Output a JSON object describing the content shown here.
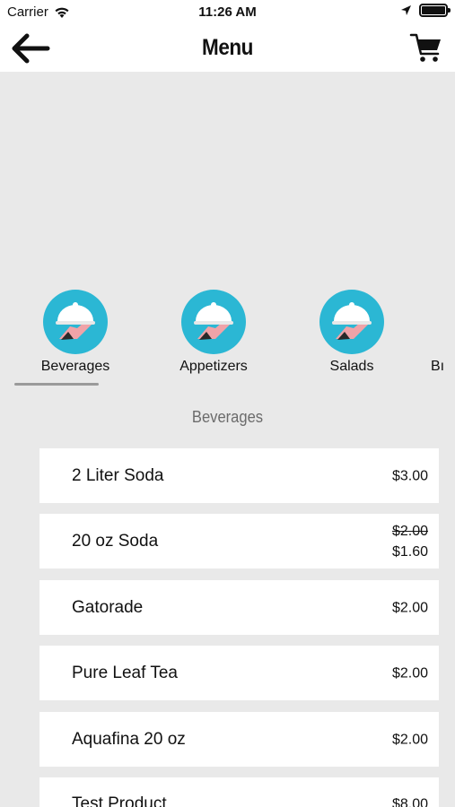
{
  "status_bar": {
    "carrier": "Carrier",
    "time": "11:26 AM"
  },
  "nav": {
    "title": "Menu"
  },
  "categories": [
    {
      "label": "Beverages",
      "selected": true
    },
    {
      "label": "Appetizers",
      "selected": false
    },
    {
      "label": "Salads",
      "selected": false
    },
    {
      "label": "Bı",
      "selected": false
    }
  ],
  "section": {
    "title": "Beverages"
  },
  "items": [
    {
      "name": "2 Liter Soda",
      "price": "$3.00"
    },
    {
      "name": "20 oz Soda",
      "original_price": "$2.00",
      "price": "$1.60"
    },
    {
      "name": "Gatorade",
      "price": "$2.00"
    },
    {
      "name": "Pure Leaf Tea",
      "price": "$2.00"
    },
    {
      "name": "Aquafina 20 oz",
      "price": "$2.00"
    },
    {
      "name": "Test Product",
      "price": "$8.00"
    }
  ],
  "colors": {
    "accent": "#2bb7d4",
    "background": "#e9e9e9",
    "card": "#ffffff"
  }
}
